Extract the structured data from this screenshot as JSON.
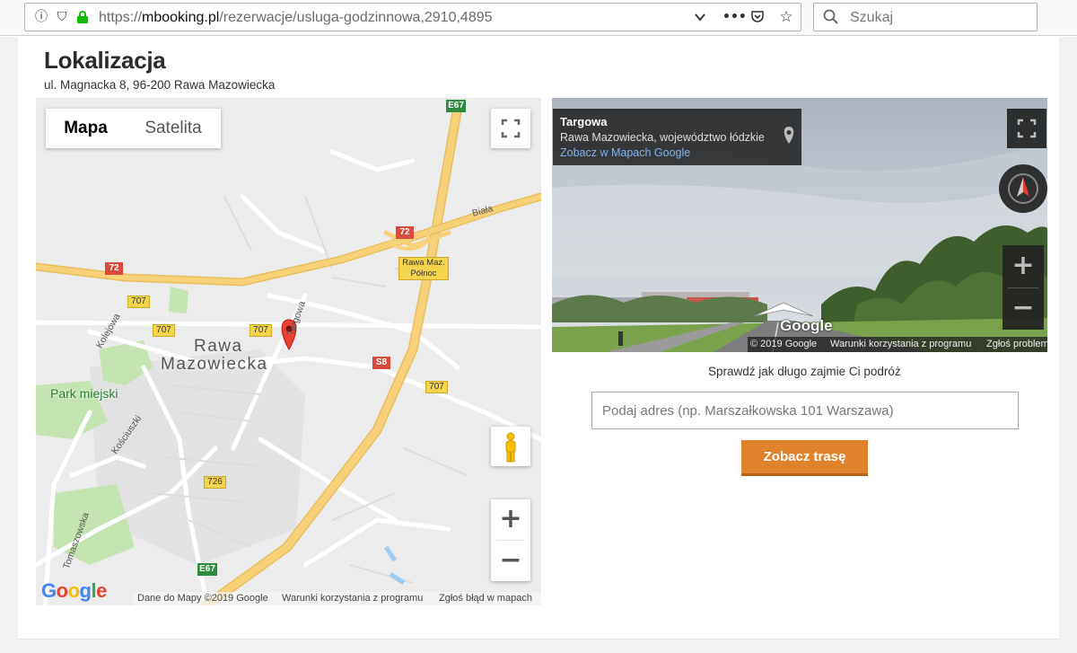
{
  "browser": {
    "url_prefix": "https://",
    "url_domain": "mbooking.pl",
    "url_path": "/rezerwacje/usluga-godzinnowa,2910,4895",
    "search_placeholder": "Szukaj",
    "icons": [
      "info-icon",
      "shield-icon",
      "lock-icon",
      "chevron-down-icon",
      "more-icon",
      "pocket-icon",
      "star-icon",
      "search-icon"
    ]
  },
  "location": {
    "title": "Lokalizacja",
    "address": "ul. Magnacka 8, 96-200 Rawa Mazowiecka"
  },
  "map": {
    "type_map": "Mapa",
    "type_satellite": "Satelita",
    "city_line1": "Rawa",
    "city_line2": "Mazowiecka",
    "park": "Park miejski",
    "street_targowa": "Targowa",
    "street_kolejowa": "Kolejowa",
    "street_kosciuszki": "Kościuszki",
    "street_tomaszowska": "Tomaszowska",
    "river": "Biała",
    "junction_line1": "Rawa Maz.",
    "junction_line2": "Północ",
    "roads": {
      "e67_top": "E67",
      "e67_bottom": "E67",
      "r72a": "72",
      "r72b": "72",
      "r707a": "707",
      "r707b": "707",
      "r707c": "707",
      "r707d": "707",
      "s8": "S8",
      "r726": "726"
    },
    "google": [
      "G",
      "o",
      "o",
      "g",
      "l",
      "e"
    ],
    "footer_data": "Dane do Mapy ©2019 Google",
    "footer_terms": "Warunki korzystania z programu",
    "footer_report": "Zgłoś błąd w mapach",
    "zoom_in": "+",
    "zoom_out": "−",
    "colors": {
      "highway": "#f8d27a",
      "road": "#ffffff",
      "park": "#c4e4b1",
      "marker": "#ea4335"
    }
  },
  "streetview": {
    "place": "Targowa",
    "region": "Rawa Mazowiecka, województwo łódzkie",
    "link": "Zobacz w Mapach Google",
    "google": "Google",
    "footer_copy": "© 2019 Google",
    "footer_terms": "Warunki korzystania z programu",
    "footer_report": "Zgłoś problem",
    "zoom_in": "+",
    "zoom_out": "−"
  },
  "route": {
    "label": "Sprawdź jak długo zajmie Ci podróż",
    "placeholder": "Podaj adres (np. Marszałkowska 101 Warszawa)",
    "button": "Zobacz trasę",
    "button_color": "#e0832c"
  }
}
